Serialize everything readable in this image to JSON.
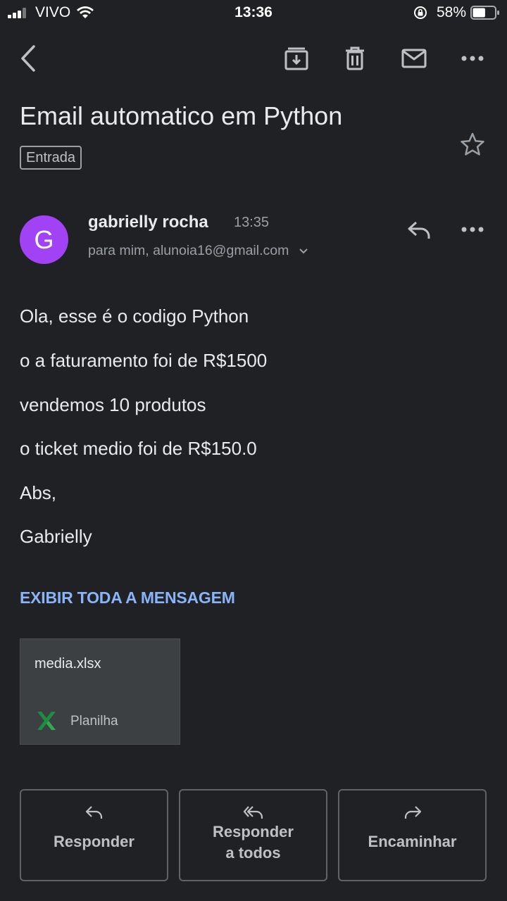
{
  "status_bar": {
    "carrier": "VIVO",
    "time": "13:36",
    "battery_percent": "58%",
    "battery_level": 0.58
  },
  "toolbar": {
    "icons": [
      "back-arrow-icon",
      "archive-icon",
      "trash-icon",
      "mark-unread-icon",
      "more-options-icon"
    ]
  },
  "email": {
    "subject": "Email automatico em Python",
    "label": "Entrada",
    "sender": {
      "initial": "G",
      "name": "gabrielly rocha",
      "time": "13:35",
      "recipients": "para mim, alunoia16@gmail.com",
      "avatar_color": "#a142f4"
    },
    "body_lines": [
      "Ola, esse é o codigo Python",
      "o a faturamento foi de R$1500",
      "vendemos 10 produtos",
      "o ticket medio foi de R$150.0",
      "Abs,",
      "Gabrielly"
    ],
    "show_full_message": "EXIBIR TODA A MENSAGEM",
    "attachment": {
      "filename": "media.xlsx",
      "type": "Planilha"
    }
  },
  "actions": {
    "reply": "Responder",
    "reply_all_line1": "Responder",
    "reply_all_line2": "a todos",
    "forward": "Encaminhar"
  },
  "colors": {
    "background": "#202124",
    "link": "#8ab4f8",
    "excel_green": "#1e8e3e"
  }
}
